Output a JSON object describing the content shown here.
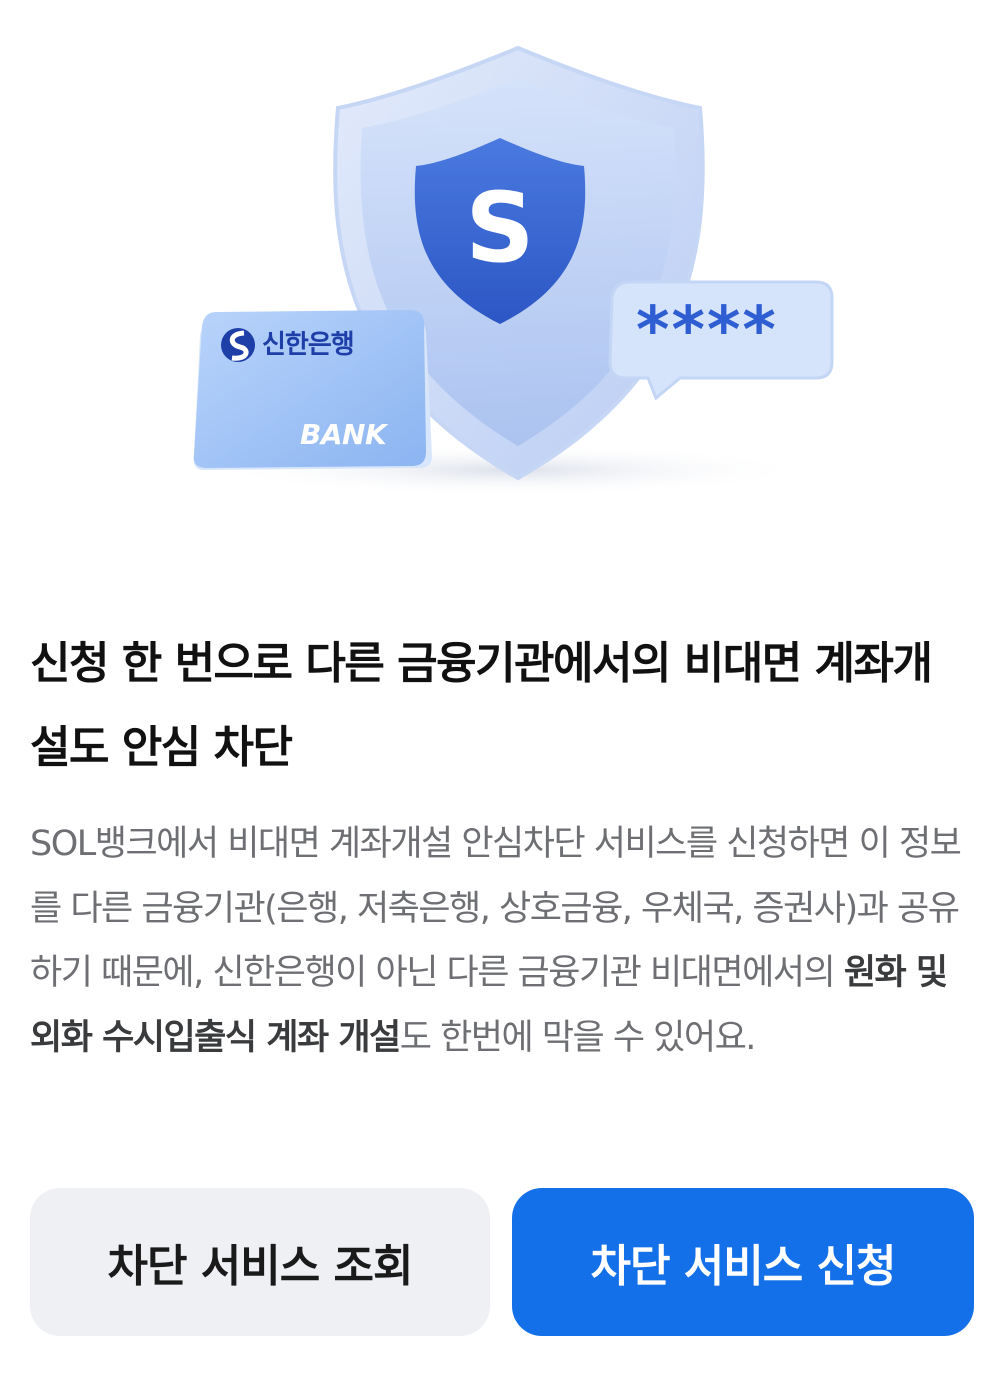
{
  "illustration": {
    "card_brand": "신한은행",
    "card_label": "BANK",
    "shield_letter": "S",
    "bubble_text": "****",
    "colors": {
      "shield_outer": "#cfdcf7",
      "shield_inner": "#3b6bd8",
      "card": "#9ec0f5"
    },
    "icons": [
      "shield-icon",
      "bank-card-icon",
      "password-bubble-icon"
    ]
  },
  "headline": "신청 한 번으로 다른 금융기관에서의 비대면 계좌개설도 안심 차단",
  "description": {
    "part1": "SOL뱅크에서 비대면 계좌개설 안심차단 서비스를 신청하면 이 정보를 다른 금융기관(은행, 저축은행, 상호금융, 우체국, 증권사)과 공유하기 때문에, 신한은행이 아닌 다른 금융기관 비대면에서의 ",
    "emphasis": "원화 및 외화 수시입출식 계좌 개설",
    "part2": "도 한번에 막을 수 있어요."
  },
  "buttons": {
    "lookup": "차단 서비스 조회",
    "apply": "차단 서비스 신청"
  },
  "colors": {
    "primary": "#1470e8",
    "secondary_bg": "#eef0f4"
  }
}
